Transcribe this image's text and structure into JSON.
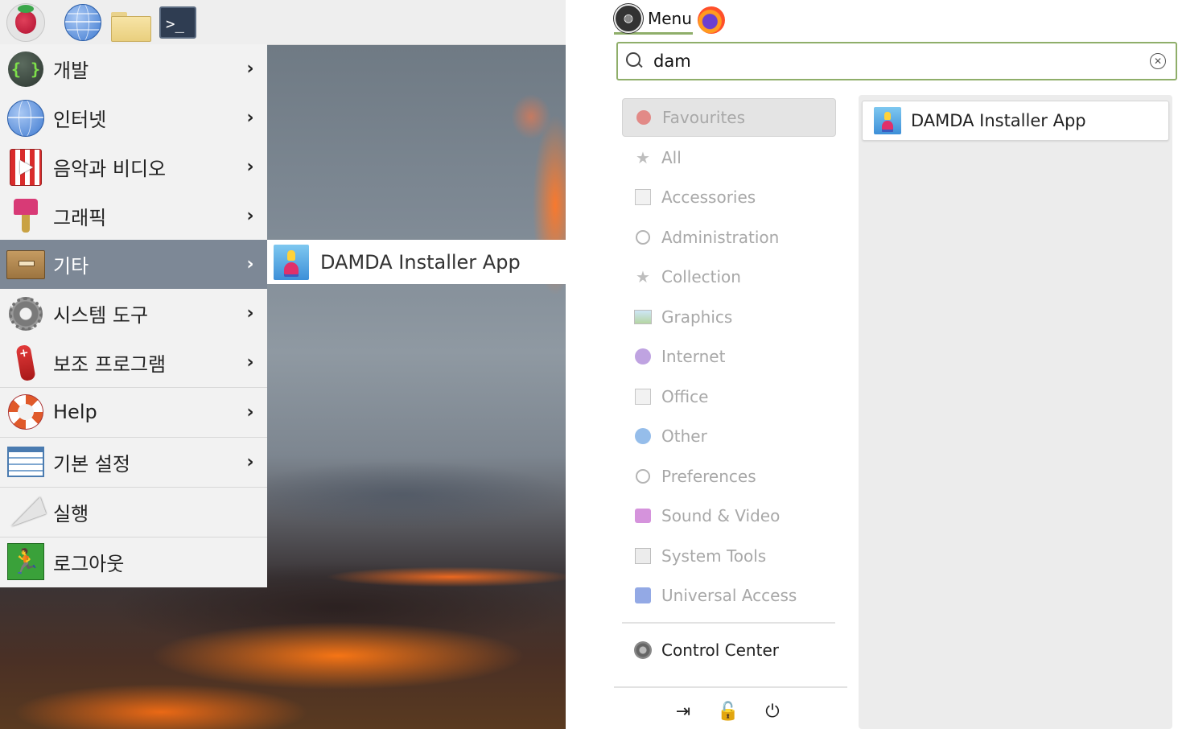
{
  "left_panel": {
    "taskbar": {
      "icons": [
        "raspberry-pi-icon",
        "web-browser-icon",
        "file-manager-icon",
        "terminal-icon"
      ],
      "terminal_glyph": ">_"
    },
    "menu": {
      "items": [
        {
          "label": "개발",
          "icon": "development-icon",
          "has_submenu": true
        },
        {
          "label": "인터넷",
          "icon": "internet-icon",
          "has_submenu": true
        },
        {
          "label": "음악과 비디오",
          "icon": "sound-video-icon",
          "has_submenu": true
        },
        {
          "label": "그래픽",
          "icon": "graphics-icon",
          "has_submenu": true
        },
        {
          "label": "기타",
          "icon": "other-icon",
          "has_submenu": true,
          "selected": true
        },
        {
          "label": "시스템 도구",
          "icon": "system-tools-icon",
          "has_submenu": true
        },
        {
          "label": "보조 프로그램",
          "icon": "accessories-icon",
          "has_submenu": true
        },
        {
          "label": "Help",
          "icon": "help-icon",
          "has_submenu": true
        },
        {
          "label": "기본 설정",
          "icon": "preferences-icon",
          "has_submenu": true
        },
        {
          "label": "실행",
          "icon": "run-icon",
          "has_submenu": false
        },
        {
          "label": "로그아웃",
          "icon": "logout-icon",
          "has_submenu": false
        }
      ],
      "chevron": "›"
    },
    "submenu": {
      "items": [
        {
          "label": "DAMDA Installer App",
          "icon": "damda-app-icon"
        }
      ]
    },
    "selected_color": "#7d8896"
  },
  "right_panel": {
    "menu_button": {
      "label": "Menu",
      "icon": "linux-mint-icon"
    },
    "panel_launcher_icon": "firefox-icon",
    "search": {
      "value": "dam",
      "placeholder": ""
    },
    "categories": [
      {
        "label": "Favourites",
        "icon": "favourites-icon",
        "selected": true
      },
      {
        "label": "All",
        "icon": "star-icon"
      },
      {
        "label": "Accessories",
        "icon": "accessories-icon"
      },
      {
        "label": "Administration",
        "icon": "administration-icon"
      },
      {
        "label": "Collection",
        "icon": "star-icon"
      },
      {
        "label": "Graphics",
        "icon": "graphics-icon"
      },
      {
        "label": "Internet",
        "icon": "internet-icon"
      },
      {
        "label": "Office",
        "icon": "office-icon"
      },
      {
        "label": "Other",
        "icon": "other-icon"
      },
      {
        "label": "Preferences",
        "icon": "preferences-icon"
      },
      {
        "label": "Sound & Video",
        "icon": "sound-video-icon"
      },
      {
        "label": "System Tools",
        "icon": "system-tools-icon"
      },
      {
        "label": "Universal Access",
        "icon": "universal-access-icon"
      }
    ],
    "control_center": {
      "label": "Control Center",
      "icon": "control-center-icon"
    },
    "bottom_buttons": [
      {
        "name": "logout-icon",
        "glyph": "⇥"
      },
      {
        "name": "lock-icon",
        "glyph": "🔓"
      },
      {
        "name": "power-icon",
        "glyph": "⏻"
      }
    ],
    "results": [
      {
        "label": "DAMDA Installer App",
        "icon": "damda-app-icon"
      }
    ],
    "accent_color": "#8fae6a"
  }
}
